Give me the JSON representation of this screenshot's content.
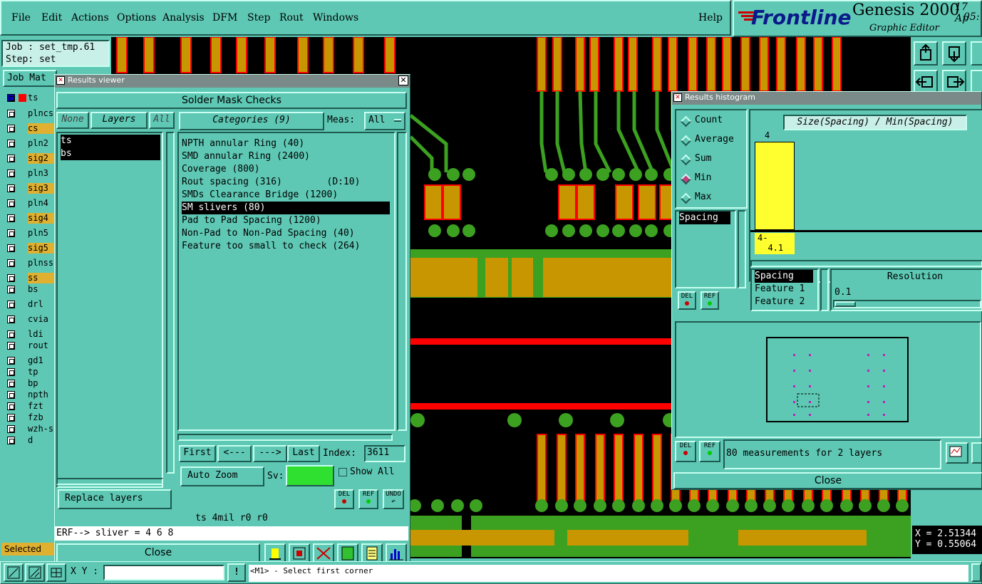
{
  "menu": {
    "file": "File",
    "edit": "Edit",
    "actions": "Actions",
    "options": "Options",
    "analysis": "Analysis",
    "dfm": "DFM",
    "step": "Step",
    "rout": "Rout",
    "windows": "Windows",
    "help": "Help"
  },
  "brand": {
    "logo": "Frontline",
    "product": "Genesis 2000",
    "subtitle": "Graphic Editor",
    "date": "17 Ap",
    "time": "05:"
  },
  "job": {
    "job_line": "Job : set_tmp.61",
    "step_line": "Step: set",
    "matrix_label": "Job Mat"
  },
  "layers": [
    {
      "name": "ts",
      "color": "#5ec8b4"
    },
    {
      "name": "plncs",
      "color": "#5ec8b4"
    },
    {
      "name": "cs",
      "color": "#e0b030"
    },
    {
      "name": "pln2",
      "color": "#5ec8b4"
    },
    {
      "name": "sig2",
      "color": "#e0b030"
    },
    {
      "name": "pln3",
      "color": "#5ec8b4"
    },
    {
      "name": "sig3",
      "color": "#e0b030"
    },
    {
      "name": "pln4",
      "color": "#5ec8b4"
    },
    {
      "name": "sig4",
      "color": "#e0b030"
    },
    {
      "name": "pln5",
      "color": "#5ec8b4"
    },
    {
      "name": "sig5",
      "color": "#e0b030"
    },
    {
      "name": "plnss",
      "color": "#5ec8b4"
    },
    {
      "name": "ss",
      "color": "#e0b030"
    },
    {
      "name": "bs",
      "color": "#5ec8b4"
    },
    {
      "name": "drl",
      "color": "#5ec8b4"
    },
    {
      "name": "cvia",
      "color": "#5ec8b4"
    },
    {
      "name": "ldi",
      "color": "#5ec8b4"
    },
    {
      "name": "rout",
      "color": "#5ec8b4"
    },
    {
      "name": "gd1",
      "color": "#5ec8b4"
    },
    {
      "name": "tp",
      "color": "#5ec8b4"
    },
    {
      "name": "bp",
      "color": "#5ec8b4"
    },
    {
      "name": "npth",
      "color": "#5ec8b4"
    },
    {
      "name": "fzt",
      "color": "#5ec8b4"
    },
    {
      "name": "fzb",
      "color": "#5ec8b4"
    },
    {
      "name": "wzh-s",
      "color": "#5ec8b4"
    },
    {
      "name": "d",
      "color": "#5ec8b4"
    }
  ],
  "selected_label": "Selected",
  "viewer": {
    "title": "Results viewer",
    "heading": "Solder Mask Checks",
    "none_btn": "None",
    "layers_btn": "Layers",
    "all_btn": "All",
    "categories_btn": "Categories (9)",
    "meas_label": "Meas:",
    "meas_value": "All",
    "layer_list": [
      "ts",
      "bs"
    ],
    "categories": [
      "NPTH annular Ring (40)",
      "SMD annular Ring (2400)",
      "Coverage (800)",
      "Rout spacing (316)        (D:10)",
      "SMDs Clearance Bridge (1200)",
      "SM slivers (80)",
      "Pad to Pad Spacing (1200)",
      "Non-Pad to Non-Pad Spacing (40)",
      "Feature too small to check (264)"
    ],
    "first_btn": "First",
    "prev_btn": "<---",
    "next_btn": "--->",
    "last_btn": "Last",
    "index_label": "Index:",
    "index_value": "3611",
    "autozoom": "Auto Zoom",
    "sv_label": "Sv:",
    "show_all": "Show All",
    "replace": "Replace layers",
    "del": "DEL",
    "ref": "REF",
    "undo": "UNDO",
    "info": "ts 4mil  r0  r0",
    "erf": "ERF--> sliver = 4 6 8",
    "close": "Close"
  },
  "histogram": {
    "title": "Results histogram",
    "modes": [
      "Count",
      "Average",
      "Sum",
      "Min",
      "Max"
    ],
    "measure_title": "Size(Spacing) / Min(Spacing)",
    "bar_count": "4",
    "bin_label": "4-\n  4.1",
    "spacing_list": [
      "Spacing"
    ],
    "attr_list": [
      "Spacing",
      "Feature 1",
      "Feature 2"
    ],
    "resolution_label": "Resolution",
    "resolution_value": "0.1",
    "del": "DEL",
    "ref": "REF",
    "status": "80 measurements for 2 layers",
    "close": "Close"
  },
  "coords": {
    "x": "X = 2.51344",
    "y": "Y = 0.55064"
  },
  "bottom": {
    "xy_label": "X Y :",
    "xy_value": "",
    "prompt": "<M1> - Select first corner"
  }
}
